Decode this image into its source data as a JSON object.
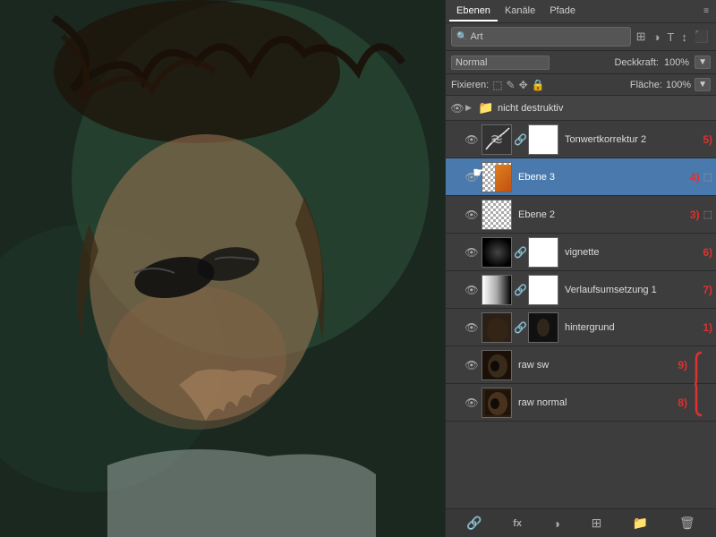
{
  "tabs": {
    "ebenen": "Ebenen",
    "kanale": "Kanäle",
    "pfade": "Pfade"
  },
  "search": {
    "placeholder": "Art",
    "dropdown_value": "Art"
  },
  "toolbar_icons": [
    "⊕",
    "⊗",
    "T",
    "↕",
    "⬛"
  ],
  "blend": {
    "mode": "Normal",
    "opacity_label": "Deckkraft:",
    "opacity_value": "100%",
    "opacity_btn": "▼"
  },
  "fix": {
    "label": "Fixieren:",
    "icons": [
      "⬚",
      "✎",
      "✥",
      "🔒"
    ],
    "fill_label": "Fläche:",
    "fill_value": "100%",
    "fill_btn": "▼"
  },
  "group": {
    "name": "nicht destruktiv"
  },
  "layers": [
    {
      "id": "tonwertkorrektur",
      "name": "Tonwertkorrektur 2",
      "badge": "5)",
      "thumb_type": "curves",
      "thumb_mask": "white",
      "has_mask": true,
      "has_link": true,
      "extra_icon": null,
      "active": false
    },
    {
      "id": "ebene3",
      "name": "Ebene 3",
      "badge": "4)",
      "thumb_type": "checker_orange",
      "has_mask": false,
      "extra_icon": "⬚",
      "active": true,
      "cursor": true
    },
    {
      "id": "ebene2",
      "name": "Ebene 2",
      "badge": "3)",
      "thumb_type": "checker",
      "has_mask": false,
      "extra_icon": "⬚",
      "active": false
    },
    {
      "id": "vignette",
      "name": "vignette",
      "badge": "6)",
      "thumb_type": "vignette",
      "thumb_mask": "white",
      "has_mask": true,
      "has_link": true,
      "extra_icon": null,
      "active": false
    },
    {
      "id": "verlaufsumsetzung",
      "name": "Verlaufsumsetzung 1",
      "badge": "7)",
      "thumb_type": "gradient_white",
      "thumb_mask": "white",
      "has_mask": true,
      "has_link": true,
      "extra_icon": null,
      "active": false
    },
    {
      "id": "hintergrund",
      "name": "hintergrund",
      "badge": "1)",
      "thumb_type": "hintergrund",
      "thumb_mask": "black_thumb",
      "has_mask": true,
      "has_link": true,
      "extra_icon": null,
      "active": false
    },
    {
      "id": "rawsw",
      "name": "raw sw",
      "badge": "9)",
      "thumb_type": "raw",
      "has_mask": false,
      "extra_icon": null,
      "active": false,
      "brace_top": true
    },
    {
      "id": "rawnormal",
      "name": "raw normal",
      "badge": "8)",
      "thumb_type": "raw2",
      "has_mask": false,
      "extra_icon": null,
      "active": false,
      "brace_bottom": true
    }
  ],
  "bottom_toolbar": {
    "icons": [
      "🔗",
      "fx",
      "◑",
      "⊞",
      "🗑"
    ]
  }
}
